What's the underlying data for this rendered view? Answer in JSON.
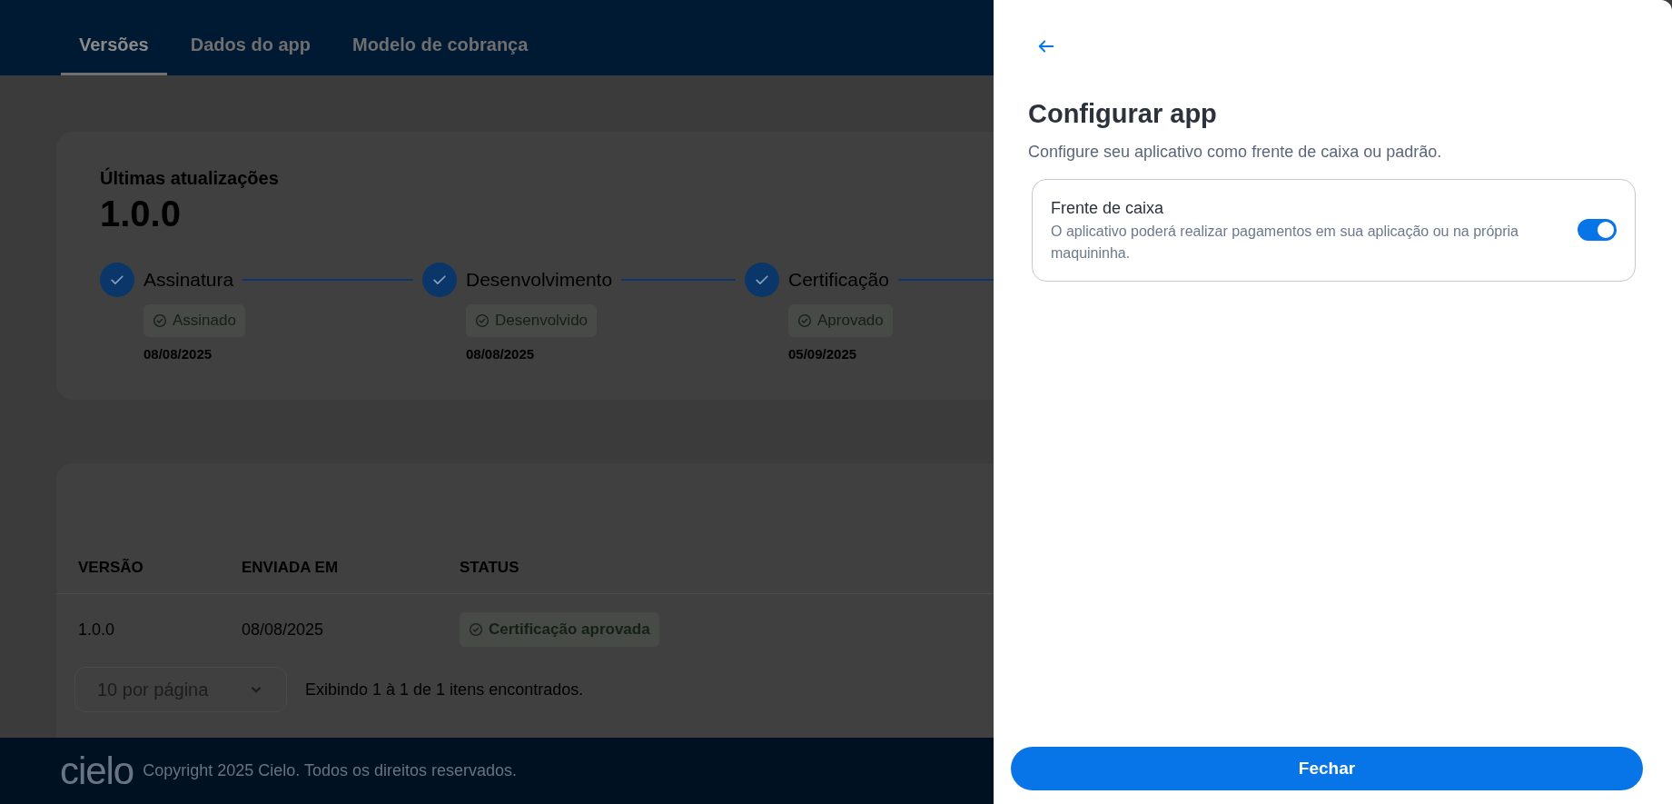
{
  "tabs": [
    {
      "label": "Versões",
      "selected": true
    },
    {
      "label": "Dados do app",
      "selected": false
    },
    {
      "label": "Modelo de cobrança",
      "selected": false
    }
  ],
  "updates": {
    "title": "Últimas atualizações",
    "version": "1.0.0",
    "steps": [
      {
        "label": "Assinatura",
        "badge": "Assinado",
        "date": "08/08/2025",
        "done": true
      },
      {
        "label": "Desenvolvimento",
        "badge": "Desenvolvido",
        "date": "08/08/2025",
        "done": true
      },
      {
        "label": "Certificação",
        "badge": "Aprovado",
        "date": "05/09/2025",
        "done": true
      }
    ]
  },
  "table": {
    "columns": [
      "VERSÃO",
      "ENVIADA EM",
      "STATUS"
    ],
    "rows": [
      {
        "version": "1.0.0",
        "sent": "08/08/2025",
        "status": "Certificação aprovada"
      }
    ],
    "page_size": "10 por página",
    "summary": "Exibindo 1 à 1 de 1 itens encontrados."
  },
  "footer": {
    "logo": "cielo",
    "copyright": "Copyright 2025 Cielo. Todos os direitos reservados."
  },
  "drawer": {
    "title": "Configurar app",
    "subtitle": "Configure seu aplicativo como frente de caixa ou padrão.",
    "options": [
      {
        "label": "Frente de caixa",
        "description": "O aplicativo poderá realizar pagamentos em sua aplicação ou na própria maquininha.",
        "on": true
      }
    ],
    "close_button": "Fechar"
  }
}
